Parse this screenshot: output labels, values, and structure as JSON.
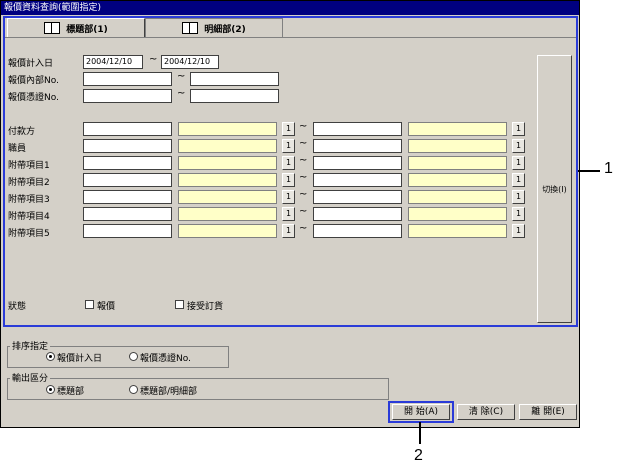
{
  "window": {
    "title": "報價資料查詢(範圍指定)"
  },
  "tabs": [
    {
      "label": "標題部(1)"
    },
    {
      "label": "明細部(2)"
    }
  ],
  "header_fields": {
    "date": {
      "label": "報價計入日",
      "from": "2004/12/10",
      "to": "2004/12/10"
    },
    "internal_no": {
      "label": "報價內部No.",
      "from": "",
      "to": ""
    },
    "reg_no": {
      "label": "報價憑證No.",
      "from": "",
      "to": ""
    }
  },
  "range_rows": [
    {
      "label": "付款方"
    },
    {
      "label": "職員"
    },
    {
      "label": "附帶項目1"
    },
    {
      "label": "附帶項目2"
    },
    {
      "label": "附帶項目3"
    },
    {
      "label": "附帶項目4"
    },
    {
      "label": "附帶項目5"
    }
  ],
  "tilde": "~",
  "search_button_label": "1",
  "switch_button": {
    "label": "切換(I)"
  },
  "status": {
    "label": "狀態",
    "options": [
      {
        "label": "報價",
        "checked": false
      },
      {
        "label": "接受訂貨",
        "checked": false
      }
    ]
  },
  "sort": {
    "title": "排序指定",
    "options": [
      {
        "label": "報價計入日",
        "selected": true
      },
      {
        "label": "報價憑證No.",
        "selected": false
      }
    ]
  },
  "output": {
    "title": "輸出區分",
    "options": [
      {
        "label": "標題部",
        "selected": true
      },
      {
        "label": "標題部/明細部",
        "selected": false
      }
    ]
  },
  "buttons": {
    "start": "開 始(A)",
    "clear": "清 除(C)",
    "close": "離 開(E)"
  },
  "callouts": {
    "one": "1",
    "two": "2"
  },
  "colors": {
    "highlight": "#2a3bd8",
    "title_bar": "#000080",
    "yellow_field": "#ffffc8"
  }
}
